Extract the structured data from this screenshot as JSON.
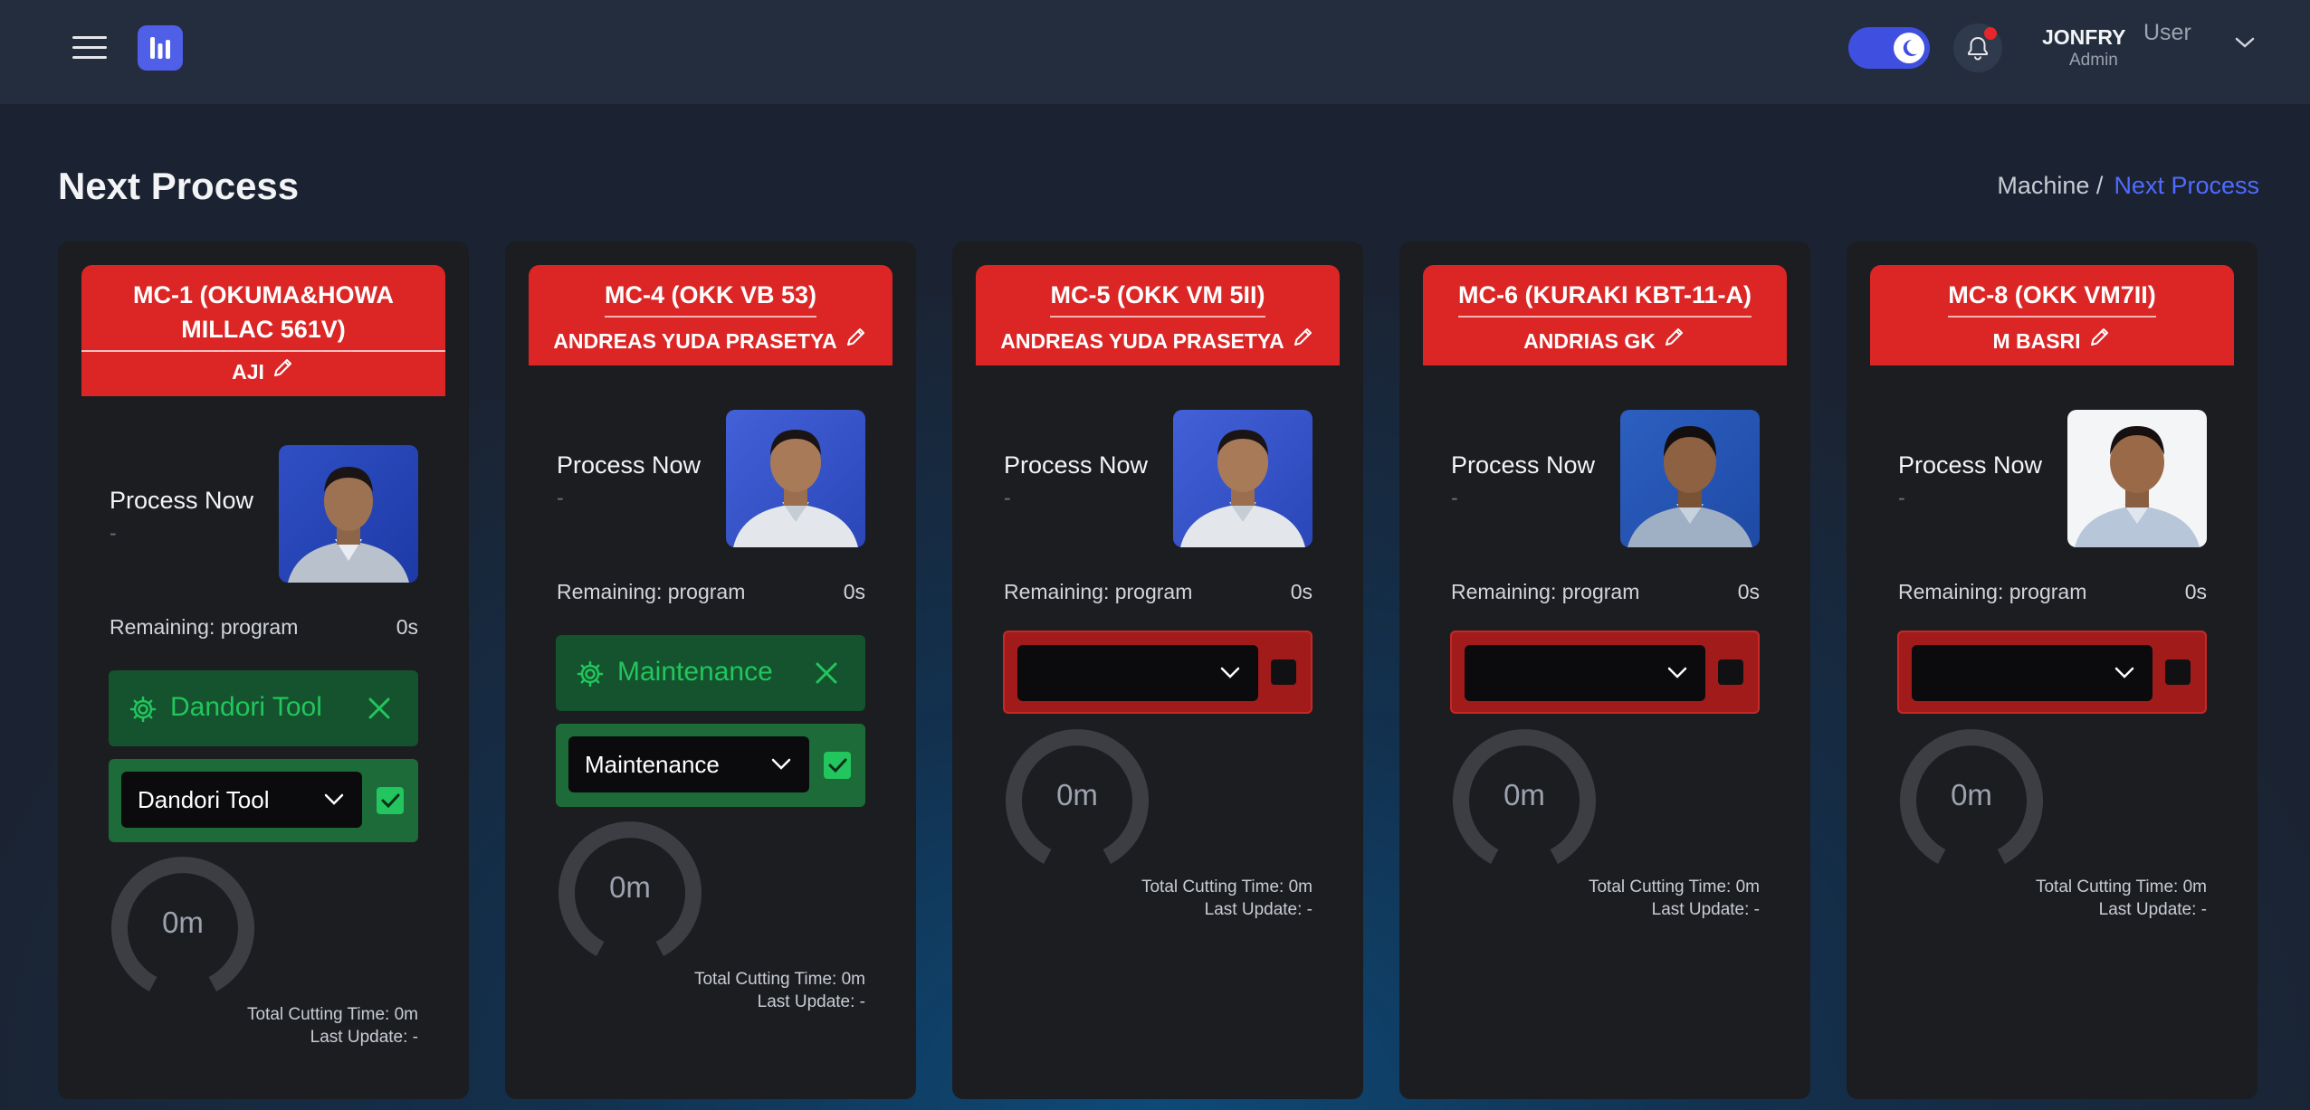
{
  "header": {
    "user_name": "JONFRY",
    "user_label": "User",
    "user_role": "Admin"
  },
  "page": {
    "title": "Next Process",
    "breadcrumb_parent": "Machine /",
    "breadcrumb_current": "Next Process"
  },
  "colors": {
    "card_header": "#dc2626",
    "accent": "#4f6bff",
    "status_green": "#22c55e"
  },
  "cards": [
    {
      "machine": "MC-1 (OKUMA&HOWA MILLAC 561V)",
      "operator": "AJI",
      "process_label": "Process Now",
      "process_value": "-",
      "remaining_label": "Remaining: program",
      "remaining_value": "0s",
      "status": "Dandori Tool",
      "select_value": "Dandori Tool",
      "gauge_value": "0m",
      "total_cutting": "Total Cutting Time: 0m",
      "last_update": "Last Update: -"
    },
    {
      "machine": "MC-4 (OKK VB 53)",
      "operator": "ANDREAS YUDA PRASETYA",
      "process_label": "Process Now",
      "process_value": "-",
      "remaining_label": "Remaining: program",
      "remaining_value": "0s",
      "status": "Maintenance",
      "select_value": "Maintenance",
      "gauge_value": "0m",
      "total_cutting": "Total Cutting Time: 0m",
      "last_update": "Last Update: -"
    },
    {
      "machine": "MC-5 (OKK VM 5II)",
      "operator": "ANDREAS YUDA PRASETYA",
      "process_label": "Process Now",
      "process_value": "-",
      "remaining_label": "Remaining: program",
      "remaining_value": "0s",
      "select_value": "",
      "gauge_value": "0m",
      "total_cutting": "Total Cutting Time: 0m",
      "last_update": "Last Update: -"
    },
    {
      "machine": "MC-6 (KURAKI KBT-11-A)",
      "operator": "ANDRIAS GK",
      "process_label": "Process Now",
      "process_value": "-",
      "remaining_label": "Remaining: program",
      "remaining_value": "0s",
      "select_value": "",
      "gauge_value": "0m",
      "total_cutting": "Total Cutting Time: 0m",
      "last_update": "Last Update: -"
    },
    {
      "machine": "MC-8 (OKK VM7II)",
      "operator": "M BASRI",
      "process_label": "Process Now",
      "process_value": "-",
      "remaining_label": "Remaining: program",
      "remaining_value": "0s",
      "select_value": "",
      "gauge_value": "0m",
      "total_cutting": "Total Cutting Time: 0m",
      "last_update": "Last Update: -"
    }
  ]
}
